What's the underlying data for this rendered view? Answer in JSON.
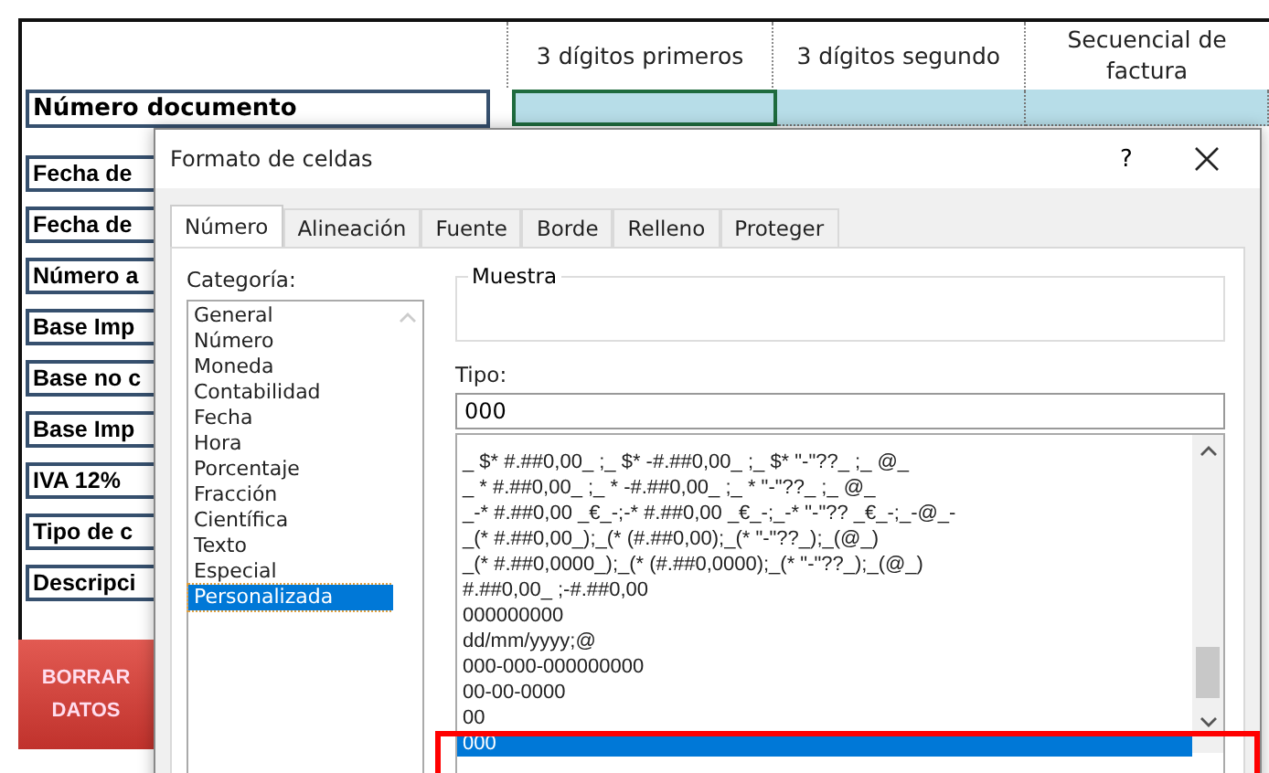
{
  "sheet": {
    "headers": [
      "3 dígitos primeros",
      "3 dígitos segundo",
      "Secuencial de factura"
    ],
    "document_label": "Número documento",
    "row_labels": [
      "Fecha de",
      "Fecha de",
      "Número a",
      "Base Imp",
      "Base no c",
      "Base Imp",
      "IVA 12%",
      "Tipo de c",
      "Descripci"
    ],
    "clear_button": "BORRAR DATOS"
  },
  "dialog": {
    "title": "Formato de celdas",
    "help": "?",
    "tabs": [
      {
        "label": "Número",
        "selected": true
      },
      {
        "label": "Alineación",
        "selected": false
      },
      {
        "label": "Fuente",
        "selected": false
      },
      {
        "label": "Borde",
        "selected": false
      },
      {
        "label": "Relleno",
        "selected": false
      },
      {
        "label": "Proteger",
        "selected": false
      }
    ],
    "category_label": "Categoría:",
    "categories": [
      {
        "label": "General",
        "selected": false
      },
      {
        "label": "Número",
        "selected": false
      },
      {
        "label": "Moneda",
        "selected": false
      },
      {
        "label": "Contabilidad",
        "selected": false
      },
      {
        "label": "Fecha",
        "selected": false
      },
      {
        "label": "Hora",
        "selected": false
      },
      {
        "label": "Porcentaje",
        "selected": false
      },
      {
        "label": "Fracción",
        "selected": false
      },
      {
        "label": "Científica",
        "selected": false
      },
      {
        "label": "Texto",
        "selected": false
      },
      {
        "label": "Especial",
        "selected": false
      },
      {
        "label": "Personalizada",
        "selected": true
      }
    ],
    "sample_label": "Muestra",
    "type_label": "Tipo:",
    "type_value": "000",
    "formats": [
      {
        "label": "_ $* #.##0,00_ ;_ $* -#.##0,00_ ;_ $* \"-\"??_ ;_ @_",
        "selected": false
      },
      {
        "label": "_ * #.##0,00_ ;_ * -#.##0,00_ ;_ * \"-\"??_ ;_ @_",
        "selected": false
      },
      {
        "label": "_-* #.##0,00 _€_-;-* #.##0,00 _€_-;_-* \"-\"?? _€_-;_-@_-",
        "selected": false
      },
      {
        "label": "_(* #.##0,00_);_(* (#.##0,00);_(* \"-\"??_);_(@_)",
        "selected": false
      },
      {
        "label": "_(* #.##0,0000_);_(* (#.##0,0000);_(* \"-\"??_);_(@_)",
        "selected": false
      },
      {
        "label": "#.##0,00_ ;-#.##0,00",
        "selected": false
      },
      {
        "label": "000000000",
        "selected": false
      },
      {
        "label": "dd/mm/yyyy;@",
        "selected": false
      },
      {
        "label": "000-000-000000000",
        "selected": false
      },
      {
        "label": "00-00-0000",
        "selected": false
      },
      {
        "label": "00",
        "selected": false
      },
      {
        "label": "000",
        "selected": true
      }
    ]
  }
}
